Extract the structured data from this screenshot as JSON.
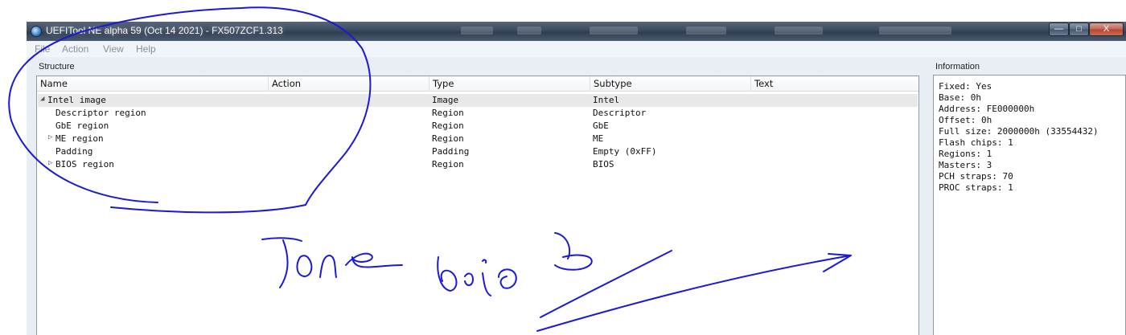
{
  "window": {
    "title": "UEFITool NE alpha 59 (Oct 14 2021) - FX507ZCF1.313",
    "controls": {
      "minimize": "—",
      "maximize": "□",
      "close": "X"
    }
  },
  "menu": [
    "File",
    "Action",
    "View",
    "Help"
  ],
  "structure": {
    "label": "Structure",
    "columns": [
      "Name",
      "Action",
      "Type",
      "Subtype",
      "Text"
    ],
    "rows": [
      {
        "expander": "◢",
        "name": "Intel image",
        "action": "",
        "type": "Image",
        "subtype": "Intel",
        "text": "",
        "selected": true
      },
      {
        "expander": "",
        "name": "Descriptor region",
        "action": "",
        "type": "Region",
        "subtype": "Descriptor",
        "text": ""
      },
      {
        "expander": "",
        "name": "GbE region",
        "action": "",
        "type": "Region",
        "subtype": "GbE",
        "text": ""
      },
      {
        "expander": "▷",
        "name": "ME region",
        "action": "",
        "type": "Region",
        "subtype": "ME",
        "text": ""
      },
      {
        "expander": "",
        "name": "Padding",
        "action": "",
        "type": "Padding",
        "subtype": "Empty (0xFF)",
        "text": ""
      },
      {
        "expander": "▷",
        "name": "BIOS region",
        "action": "",
        "type": "Region",
        "subtype": "BIOS",
        "text": ""
      }
    ]
  },
  "information": {
    "label": "Information",
    "lines": [
      "Fixed: Yes",
      "Base: 0h",
      "Address: FE000000h",
      "Offset: 0h",
      "Full size: 2000000h (33554432)",
      "Flash chips: 1",
      "Regions: 1",
      "Masters: 3",
      "PCH straps: 70",
      "PROC straps: 1"
    ]
  },
  "annotation": {
    "ink_color": "#1a1ad6",
    "handwritten_text": "Done BIOS"
  }
}
